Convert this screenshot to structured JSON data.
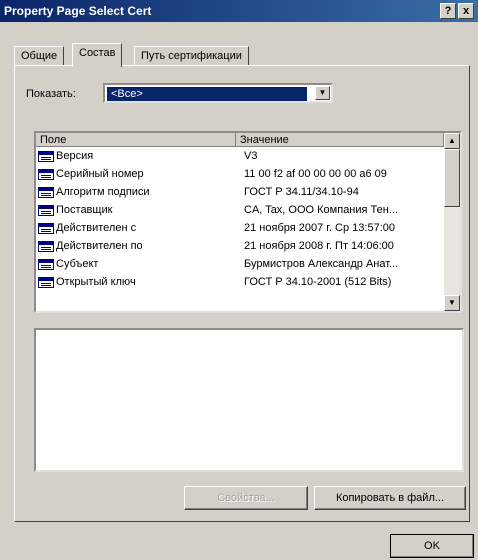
{
  "window": {
    "title": "Property Page Select Cert",
    "help_label": "?",
    "close_label": "x"
  },
  "tabs": [
    {
      "label": "Общие"
    },
    {
      "label": "Состав"
    },
    {
      "label": "Путь сертификации"
    }
  ],
  "filter": {
    "label": "Показать:",
    "selected": "<Все>"
  },
  "list": {
    "columns": [
      "Поле",
      "Значение"
    ],
    "rows": [
      {
        "field": "Версия",
        "value": "V3"
      },
      {
        "field": "Серийный номер",
        "value": "11 00 f2 af 00 00 00 00 a6 09"
      },
      {
        "field": "Алгоритм подписи",
        "value": "ГОСТ Р 34.11/34.10-94"
      },
      {
        "field": "Поставщик",
        "value": "CA, Tax, ООО Компания Тен..."
      },
      {
        "field": "Действителен с",
        "value": "21 ноября 2007 г. Ср 13:57:00"
      },
      {
        "field": "Действителен по",
        "value": "21 ноября 2008 г. Пт 14:06:00"
      },
      {
        "field": "Субъект",
        "value": "Бурмистров Александр Анат..."
      },
      {
        "field": "Открытый ключ",
        "value": "ГОСТ Р 34.10-2001 (512 Bits)"
      }
    ]
  },
  "buttons": {
    "properties": "Свойства...",
    "copy_to_file": "Копировать в файл...",
    "ok": "OK"
  }
}
